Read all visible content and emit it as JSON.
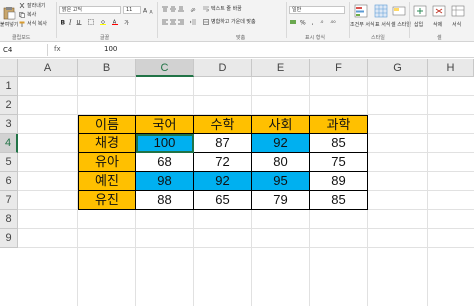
{
  "ribbon": {
    "paste_label": "붙여넣기",
    "clipboard_items": [
      "잘라내기",
      "복사",
      "서식 복사"
    ],
    "font_name": "맑은 고딕",
    "font_size": "11",
    "align_items": [
      "텍스트 줄 바꿈",
      "병합하고 가운데 맞춤"
    ],
    "number_format": "일반",
    "style_buttons": [
      "조건부 서식",
      "표 서식",
      "셀 스타일"
    ],
    "cell_buttons": [
      "삽입",
      "삭제",
      "서식"
    ],
    "group_labels": [
      "클립보드",
      "글꼴",
      "맞춤",
      "표시 형식",
      "스타일",
      "셀"
    ]
  },
  "formula_bar": {
    "name_box": "C4",
    "fx": "fx",
    "content": "100"
  },
  "columns": [
    "A",
    "B",
    "C",
    "D",
    "E",
    "F",
    "G",
    "H"
  ],
  "rows": [
    "1",
    "2",
    "3",
    "4",
    "5",
    "6",
    "7",
    "8",
    "9"
  ],
  "table": {
    "headers": [
      "이름",
      "국어",
      "수학",
      "사회",
      "과학"
    ],
    "rows": [
      {
        "name": "채경",
        "values": [
          "100",
          "87",
          "92",
          "85"
        ]
      },
      {
        "name": "유아",
        "values": [
          "68",
          "72",
          "80",
          "75"
        ]
      },
      {
        "name": "예진",
        "values": [
          "98",
          "92",
          "95",
          "89"
        ]
      },
      {
        "name": "유진",
        "values": [
          "88",
          "65",
          "79",
          "85"
        ]
      }
    ]
  },
  "colors": {
    "header_fill": "#ffc000",
    "highlight_fill": "#00b0f0",
    "selection": "#217346"
  }
}
